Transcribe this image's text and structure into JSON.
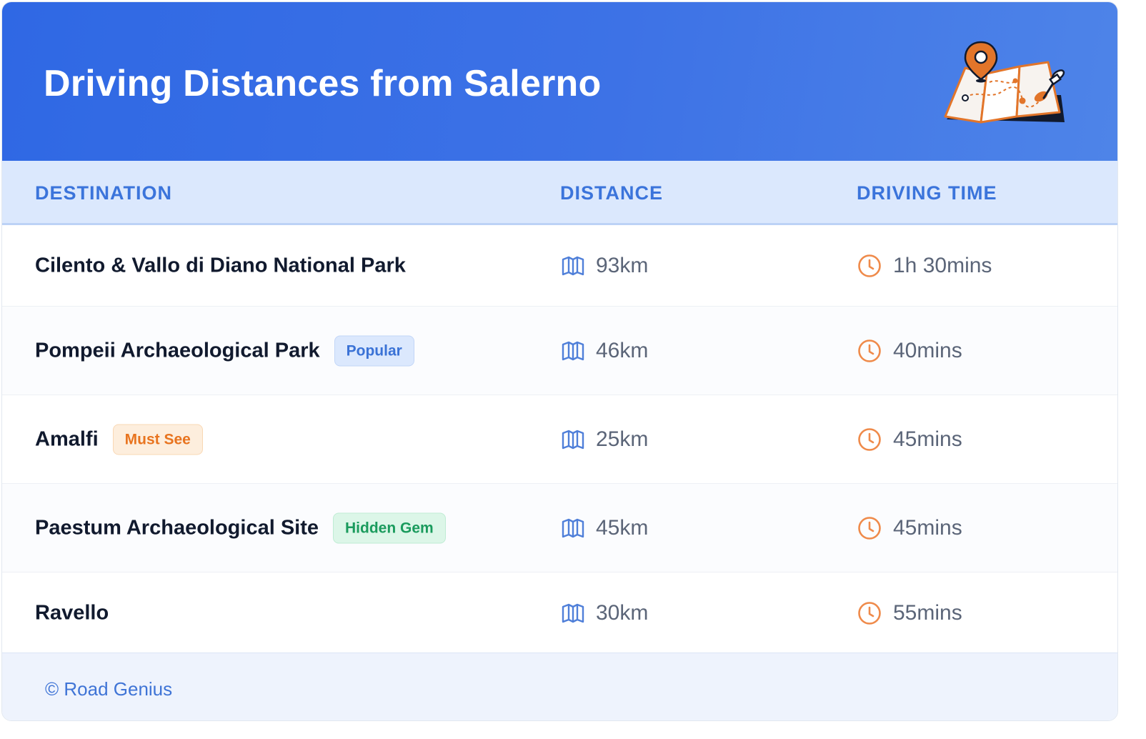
{
  "header": {
    "title": "Driving Distances from Salerno",
    "illustration": "map-with-pin-icon"
  },
  "table": {
    "columns": [
      "DESTINATION",
      "DISTANCE",
      "DRIVING TIME"
    ],
    "rows": [
      {
        "destination": "Cilento & Vallo di Diano National Park",
        "badge": null,
        "distance": "93km",
        "time": "1h 30mins"
      },
      {
        "destination": "Pompeii Archaeological Park",
        "badge": "Popular",
        "distance": "46km",
        "time": "40mins"
      },
      {
        "destination": "Amalfi",
        "badge": "Must See",
        "distance": "25km",
        "time": "45mins"
      },
      {
        "destination": "Paestum Archaeological Site",
        "badge": "Hidden Gem",
        "distance": "45km",
        "time": "45mins"
      },
      {
        "destination": "Ravello",
        "badge": null,
        "distance": "30km",
        "time": "55mins"
      }
    ],
    "row_heights": [
      114,
      124,
      124,
      124,
      114
    ]
  },
  "badges": {
    "Popular": {
      "text": "#3a72d6",
      "bg": "#dbe8fd",
      "border": "#c2d6f7"
    },
    "Must See": {
      "text": "#e8741f",
      "bg": "#fdeedd",
      "border": "#f9d8b4"
    },
    "Hidden Gem": {
      "text": "#1a9b5d",
      "bg": "#dcf6e8",
      "border": "#bfecd4"
    }
  },
  "icons": {
    "distance": "map-icon",
    "time": "clock-icon"
  },
  "colors": {
    "header_gradient_start": "#2f68e4",
    "header_gradient_end": "#4e84e8",
    "map_icon": "#4f7fd9",
    "clock_icon": "#ef8a4a",
    "accent": "#3b74db"
  },
  "footer": {
    "text": "© Road Genius"
  }
}
